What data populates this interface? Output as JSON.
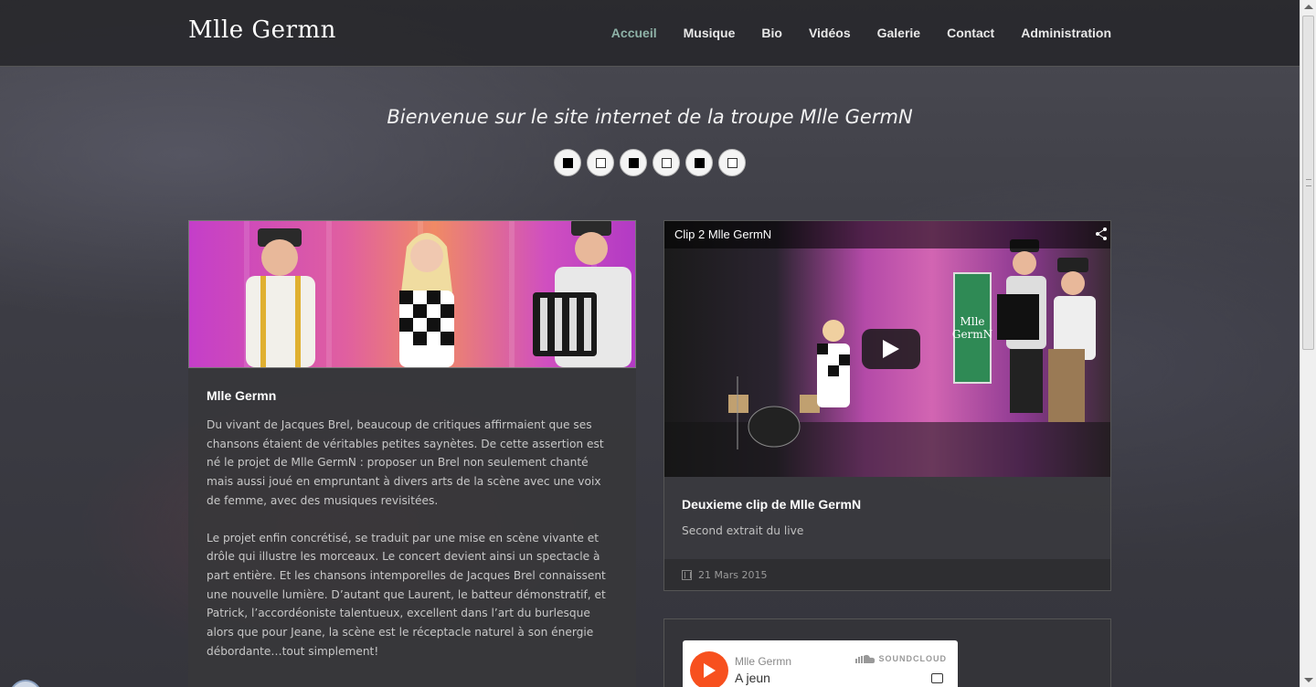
{
  "header": {
    "brand": "Mlle Germn",
    "nav": [
      "Accueil",
      "Musique",
      "Bio",
      "Vidéos",
      "Galerie",
      "Contact",
      "Administration"
    ],
    "active": "Accueil"
  },
  "hero": {
    "title": "Bienvenue sur le site internet de la troupe Mlle GermN",
    "slides": [
      "filled",
      "empty",
      "filled",
      "empty",
      "filled",
      "empty"
    ]
  },
  "intro_card": {
    "title": "Mlle Germn",
    "paragraphs": [
      "Du vivant de Jacques Brel, beaucoup de critiques affirmaient que ses chansons étaient de véritables petites saynètes. De cette assertion est né le projet de Mlle GermN : proposer un Brel non seulement chanté mais aussi joué en empruntant à divers arts de la scène avec une voix de femme, avec des musiques revisitées.",
      "Le projet enfin concrétisé, se traduit par une mise en scène vivante et drôle qui illustre les morceaux. Le concert devient ainsi un spectacle à part entière. Et les chansons intemporelles de Jacques Brel connaissent une nouvelle lumière. D’autant que Laurent, le batteur démonstratif, et Patrick, l’accordéoniste talentueux, excellent dans l’art du burlesque alors que pour Jeane, la scène est le réceptacle naturel à son énergie débordante…tout simplement!"
    ]
  },
  "video_card": {
    "player_title": "Clip 2 Mlle GermN",
    "sign_text": "Mlle GermN",
    "title": "Deuxieme clip de Mlle GermN",
    "description": "Second extrait du live",
    "date": "21 Mars 2015"
  },
  "soundcloud": {
    "artist": "Mlle Germn",
    "track": "A jeun",
    "brand": "SOUNDCLOUD"
  },
  "colors": {
    "accent_nav": "#8fb3a8",
    "soundcloud": "#f7501e"
  }
}
